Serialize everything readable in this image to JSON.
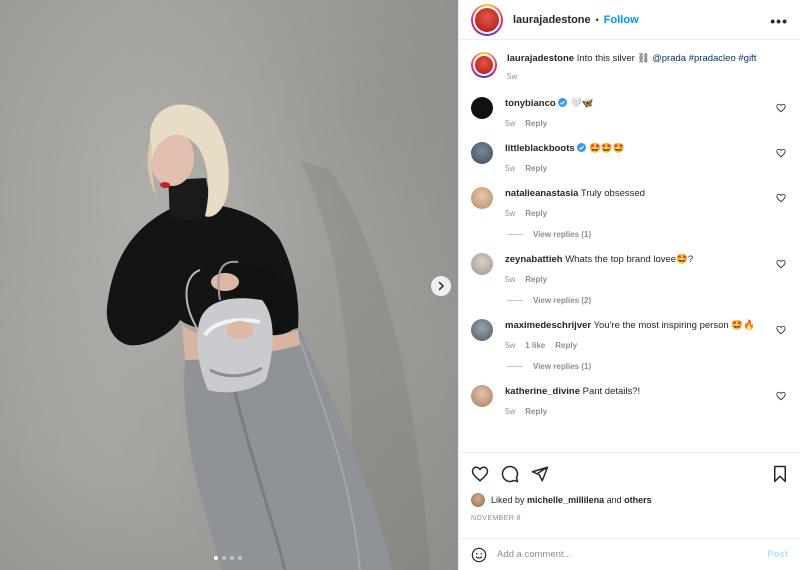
{
  "post": {
    "username": "laurajadestone",
    "follow_label": "Follow",
    "separator": "•",
    "caption": {
      "username": "laurajadestone",
      "text": "Into this silver ⛓",
      "tags": [
        "@prada",
        "#pradacleo",
        "#gift"
      ],
      "age": "5w"
    },
    "carousel": {
      "slides": 4,
      "active_index": 0
    }
  },
  "comments": [
    {
      "username": "tonybianco",
      "verified": true,
      "text": "🤍🦋",
      "age": "5w",
      "likes": "",
      "reply_label": "Reply",
      "view_replies": ""
    },
    {
      "username": "littleblackboots",
      "verified": true,
      "text": "🤩🤩🤩",
      "age": "5w",
      "likes": "",
      "reply_label": "Reply",
      "view_replies": ""
    },
    {
      "username": "natalieanastasia",
      "verified": false,
      "text": "Truly obsessed",
      "age": "5w",
      "likes": "",
      "reply_label": "Reply",
      "view_replies": "View replies (1)"
    },
    {
      "username": "zeynabattieh",
      "verified": false,
      "text": "Whats the top brand lovee🤩?",
      "age": "5w",
      "likes": "",
      "reply_label": "Reply",
      "view_replies": "View replies (2)"
    },
    {
      "username": "maximedeschrijver",
      "verified": false,
      "text": "You're the most inspiring person 🤩🔥",
      "age": "5w",
      "likes": "1 like",
      "reply_label": "Reply",
      "view_replies": "View replies (1)"
    },
    {
      "username": "katherine_divine",
      "verified": false,
      "text": "Pant details?!",
      "age": "5w",
      "likes": "",
      "reply_label": "Reply",
      "view_replies": ""
    }
  ],
  "likes": {
    "prefix": "Liked by",
    "user": "michelle_millilena",
    "joiner": "and",
    "others": "others"
  },
  "date": "NOVEMBER 8",
  "composer": {
    "placeholder": "Add a comment...",
    "post_label": "Post"
  },
  "colors": {
    "accent": "#0095f6",
    "verified": "#3897f0",
    "post_disabled": "#b2dffc",
    "muted": "#8e8e8e"
  },
  "icons": [
    "chevron-right-icon",
    "more-icon",
    "heart-icon",
    "comment-icon",
    "share-icon",
    "bookmark-icon",
    "emoji-icon",
    "verified-badge-icon"
  ]
}
